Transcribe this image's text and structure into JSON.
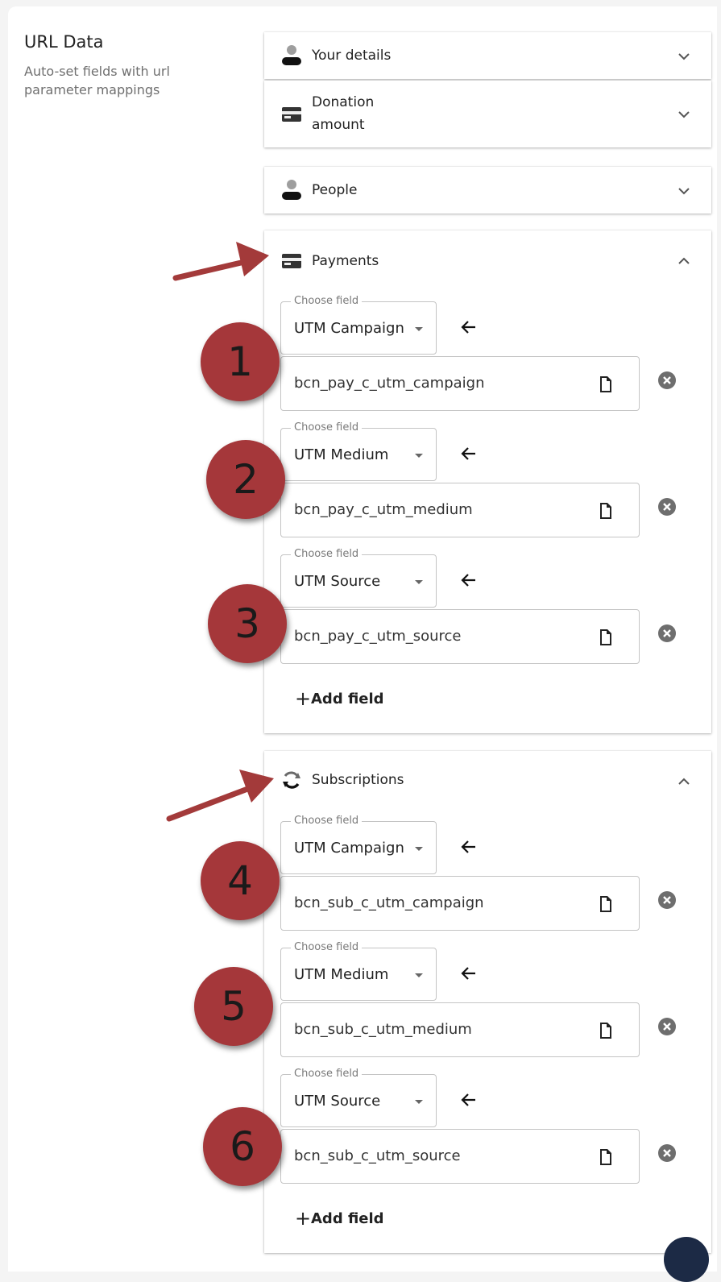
{
  "url_data": {
    "title": "URL Data",
    "description": "Auto-set fields with url parameter mappings"
  },
  "sections": {
    "your_details": {
      "title": "Your details",
      "icon": "person-icon",
      "expanded": false
    },
    "donation_amount": {
      "title": "Donation amount",
      "line1": "Donation",
      "line2": "amount",
      "icon": "credit-card-icon",
      "expanded": false
    },
    "people": {
      "title": "People",
      "icon": "person-icon",
      "expanded": false
    },
    "payments": {
      "title": "Payments",
      "icon": "credit-card-icon",
      "expanded": true,
      "rows": [
        {
          "legend": "Choose field",
          "field": "UTM Campaign",
          "param": "bcn_pay_c_utm_campaign",
          "annotation": "1"
        },
        {
          "legend": "Choose field",
          "field": "UTM Medium",
          "param": "bcn_pay_c_utm_medium",
          "annotation": "2"
        },
        {
          "legend": "Choose field",
          "field": "UTM Source",
          "param": "bcn_pay_c_utm_source",
          "annotation": "3"
        }
      ],
      "add_label": "Add field"
    },
    "subscriptions": {
      "title": "Subscriptions",
      "icon": "sync-icon",
      "expanded": true,
      "rows": [
        {
          "legend": "Choose field",
          "field": "UTM Campaign",
          "param": "bcn_sub_c_utm_campaign",
          "annotation": "4"
        },
        {
          "legend": "Choose field",
          "field": "UTM Medium",
          "param": "bcn_sub_c_utm_medium",
          "annotation": "5"
        },
        {
          "legend": "Choose field",
          "field": "UTM Source",
          "param": "bcn_sub_c_utm_source",
          "annotation": "6"
        }
      ],
      "add_label": "Add field"
    }
  },
  "colors": {
    "annotation_badge": "#a5373a",
    "annotation_arrow": "#a33a3a",
    "fab": "#1c2a45"
  }
}
